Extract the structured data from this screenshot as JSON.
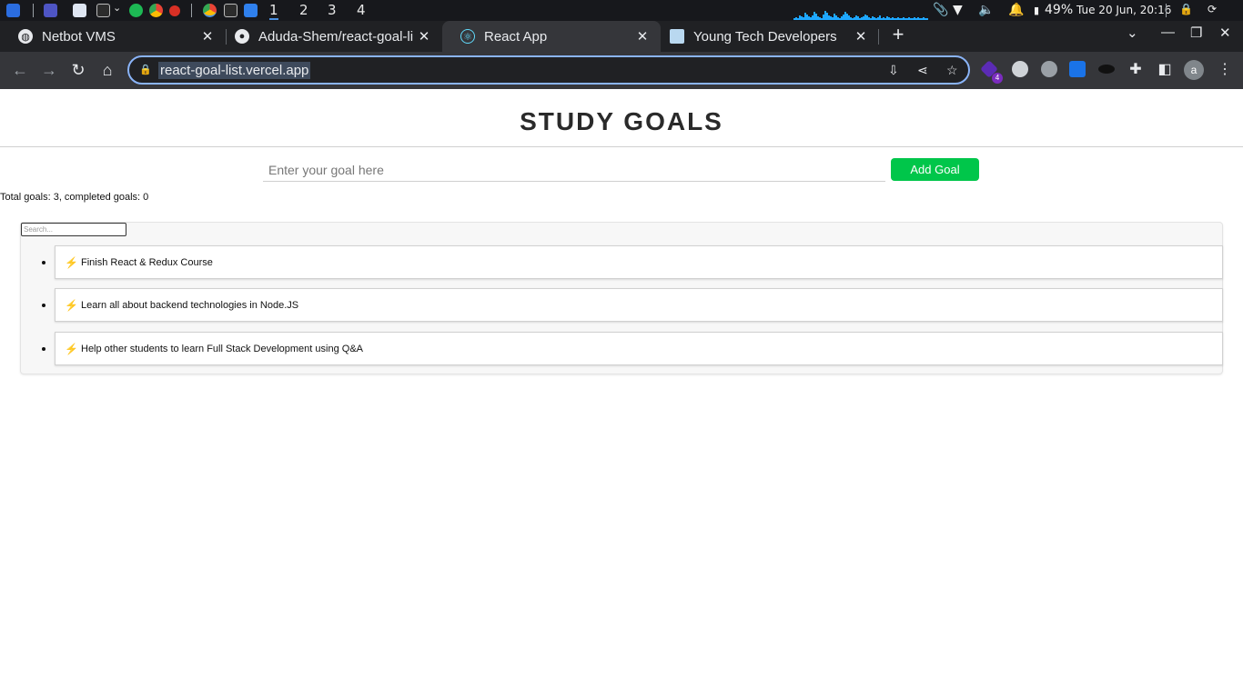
{
  "os_panel": {
    "workspaces": [
      "1",
      "2",
      "3",
      "4"
    ],
    "battery": "49%",
    "clock": "Tue 20 Jun, 20:16"
  },
  "browser": {
    "tabs": [
      {
        "title": "Netbot VMS",
        "favicon": "globe-icon"
      },
      {
        "title": "Aduda-Shem/react-goal-li",
        "favicon": "github-icon"
      },
      {
        "title": "React App",
        "favicon": "react-icon"
      },
      {
        "title": "Young Tech Developers",
        "favicon": "site-icon"
      }
    ],
    "url": "react-goal-list.vercel.app",
    "profile_initial": "a",
    "extension_badge": "4"
  },
  "app": {
    "title": "STUDY GOALS",
    "input_placeholder": "Enter your goal here",
    "add_button": "Add Goal",
    "stats": "Total goals: 3, completed goals: 0",
    "search_placeholder": "Search...",
    "goals": [
      "Finish React & Redux Course",
      "Learn all about backend technologies in Node.JS",
      "Help other students to learn Full Stack Development using Q&A"
    ]
  },
  "colors": {
    "accent_green": "#00c64a",
    "focus_blue": "#8ab4f8",
    "bolt": "#f2b400"
  }
}
